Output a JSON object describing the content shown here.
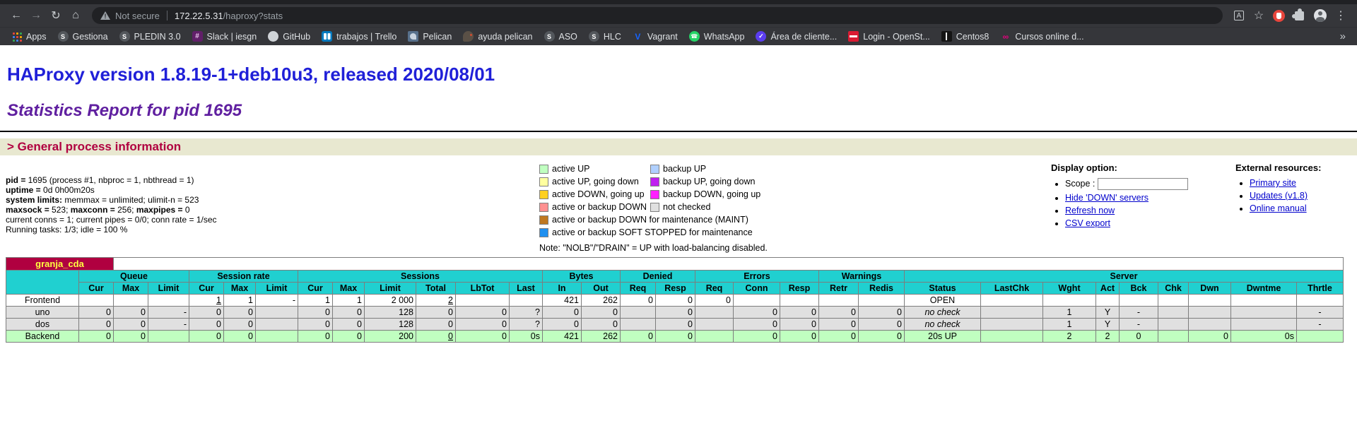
{
  "browser": {
    "security_label": "Not secure",
    "url": {
      "host": "172.22.5.31",
      "path": "/haproxy?stats"
    },
    "icons": {
      "back": "←",
      "forward": "→",
      "reload": "↻",
      "home": "⌂",
      "translate": "A",
      "star": "☆",
      "menu": "⋮"
    },
    "overflow_chevron": "»",
    "bookmarks": [
      {
        "label": "Apps",
        "icon": "apps-grid"
      },
      {
        "label": "Gestiona",
        "icon": "globe"
      },
      {
        "label": "PLEDIN 3.0",
        "icon": "globe"
      },
      {
        "label": "Slack | iesgn",
        "icon": "slack"
      },
      {
        "label": "GitHub",
        "icon": "github"
      },
      {
        "label": "trabajos | Trello",
        "icon": "trello"
      },
      {
        "label": "Pelican",
        "icon": "pelican"
      },
      {
        "label": "ayuda pelican",
        "icon": "bird"
      },
      {
        "label": "ASO",
        "icon": "globe"
      },
      {
        "label": "HLC",
        "icon": "globe"
      },
      {
        "label": "Vagrant",
        "icon": "vagrant"
      },
      {
        "label": "WhatsApp",
        "icon": "whatsapp"
      },
      {
        "label": "Área de cliente...",
        "icon": "area"
      },
      {
        "label": "Login - OpenSt...",
        "icon": "openstack"
      },
      {
        "label": "Centos8",
        "icon": "centos"
      },
      {
        "label": "Cursos online d...",
        "icon": "cursos"
      }
    ]
  },
  "page": {
    "h1": "HAProxy version 1.8.19-1+deb10u3, released 2020/08/01",
    "h2": "Statistics Report for pid 1695",
    "h3": "> General process information",
    "colors": {
      "h1_link": "#2020d8",
      "h2_title": "#6020a0",
      "section_fg": "#b00040",
      "section_bg": "#e8e8d0",
      "table_header_bg": "#20d0d0",
      "pxname_bg": "#b00040",
      "pxname_fg": "#ffff40",
      "link_blue": "#0000cc"
    },
    "proc_info": [
      [
        {
          "t": "pid = ",
          "b": true
        },
        {
          "t": "1695 (process #1, nbproc = 1, nbthread = 1)"
        }
      ],
      [
        {
          "t": "uptime = ",
          "b": true
        },
        {
          "t": "0d 0h00m20s"
        }
      ],
      [
        {
          "t": "system limits:",
          "b": true
        },
        {
          "t": " memmax = unlimited; ulimit-n = 523"
        }
      ],
      [
        {
          "t": "maxsock = ",
          "b": true
        },
        {
          "t": "523; "
        },
        {
          "t": "maxconn = ",
          "b": true
        },
        {
          "t": "256; "
        },
        {
          "t": "maxpipes = ",
          "b": true
        },
        {
          "t": "0"
        }
      ],
      [
        {
          "t": "current conns = 1; current pipes = 0/0; conn rate = 1/sec"
        }
      ],
      [
        {
          "t": "Running tasks: 1/3; idle = 100 %"
        }
      ]
    ],
    "legend": {
      "rows": [
        [
          {
            "label": "active UP",
            "color": "#c0ffc0"
          },
          {
            "label": "backup UP",
            "color": "#b0d0ff"
          }
        ],
        [
          {
            "label": "active UP, going down",
            "color": "#ffffa0"
          },
          {
            "label": "backup UP, going down",
            "color": "#c020f0"
          }
        ],
        [
          {
            "label": "active DOWN, going up",
            "color": "#ffd020"
          },
          {
            "label": "backup DOWN, going up",
            "color": "#ff20ff"
          }
        ],
        [
          {
            "label": "active or backup DOWN",
            "color": "#ff9090"
          },
          {
            "label": "not checked",
            "color": "#e0e0e0"
          }
        ]
      ],
      "wide": [
        {
          "label": "active or backup DOWN for maintenance (MAINT)",
          "color": "#c07820"
        },
        {
          "label": "active or backup SOFT STOPPED for maintenance",
          "color": "#2090f0"
        }
      ],
      "note": "Note: \"NOLB\"/\"DRAIN\" = UP with load-balancing disabled."
    },
    "display_option": {
      "title": "Display option:",
      "scope_label": "Scope :",
      "links": [
        "Hide 'DOWN' servers",
        "Refresh now",
        "CSV export"
      ]
    },
    "external_resources": {
      "title": "External resources:",
      "links": [
        "Primary site",
        "Updates (v1.8)",
        "Online manual"
      ]
    },
    "table": {
      "proxy_name": "granja_cda",
      "groups": [
        {
          "label": "Queue",
          "span": 3
        },
        {
          "label": "Session rate",
          "span": 3
        },
        {
          "label": "Sessions",
          "span": 6
        },
        {
          "label": "Bytes",
          "span": 2
        },
        {
          "label": "Denied",
          "span": 2
        },
        {
          "label": "Errors",
          "span": 3
        },
        {
          "label": "Warnings",
          "span": 2
        },
        {
          "label": "Server",
          "span": 9
        }
      ],
      "columns": [
        "Cur",
        "Max",
        "Limit",
        "Cur",
        "Max",
        "Limit",
        "Cur",
        "Max",
        "Limit",
        "Total",
        "LbTot",
        "Last",
        "In",
        "Out",
        "Req",
        "Resp",
        "Req",
        "Conn",
        "Resp",
        "Retr",
        "Redis",
        "Status",
        "LastChk",
        "Wght",
        "Act",
        "Bck",
        "Chk",
        "Dwn",
        "Dwntme",
        "Thrtle"
      ],
      "rows": [
        {
          "name": "Frontend",
          "bg": "#ffffff",
          "cells": [
            "",
            "",
            "",
            {
              "v": "1",
              "u": true
            },
            "1",
            "-",
            "1",
            "1",
            "2 000",
            {
              "v": "2",
              "u": true
            },
            "",
            "",
            "421",
            "262",
            "0",
            "0",
            "0",
            "",
            "",
            "",
            "",
            "OPEN",
            "",
            "",
            "",
            "",
            "",
            "",
            "",
            ""
          ]
        },
        {
          "name": "uno",
          "bg": "#e0e0e0",
          "cells": [
            "0",
            "0",
            "-",
            "0",
            "0",
            "",
            "0",
            "0",
            "128",
            "0",
            "0",
            "?",
            "0",
            "0",
            "",
            "0",
            "",
            "0",
            "0",
            "0",
            "0",
            {
              "v": "no check",
              "i": true
            },
            "",
            "1",
            "Y",
            "-",
            "",
            "",
            "",
            "-"
          ]
        },
        {
          "name": "dos",
          "bg": "#e0e0e0",
          "cells": [
            "0",
            "0",
            "-",
            "0",
            "0",
            "",
            "0",
            "0",
            "128",
            "0",
            "0",
            "?",
            "0",
            "0",
            "",
            "0",
            "",
            "0",
            "0",
            "0",
            "0",
            {
              "v": "no check",
              "i": true
            },
            "",
            "1",
            "Y",
            "-",
            "",
            "",
            "",
            "-"
          ]
        },
        {
          "name": "Backend",
          "bg": "#c0ffc0",
          "cells": [
            "0",
            "0",
            "",
            "0",
            "0",
            "",
            "0",
            "0",
            "200",
            {
              "v": "0",
              "u": true
            },
            "0",
            "0s",
            "421",
            "262",
            "0",
            "0",
            "",
            "0",
            "0",
            "0",
            "0",
            "20s UP",
            "",
            "2",
            "2",
            "0",
            "",
            "0",
            "0s",
            ""
          ]
        }
      ]
    }
  }
}
